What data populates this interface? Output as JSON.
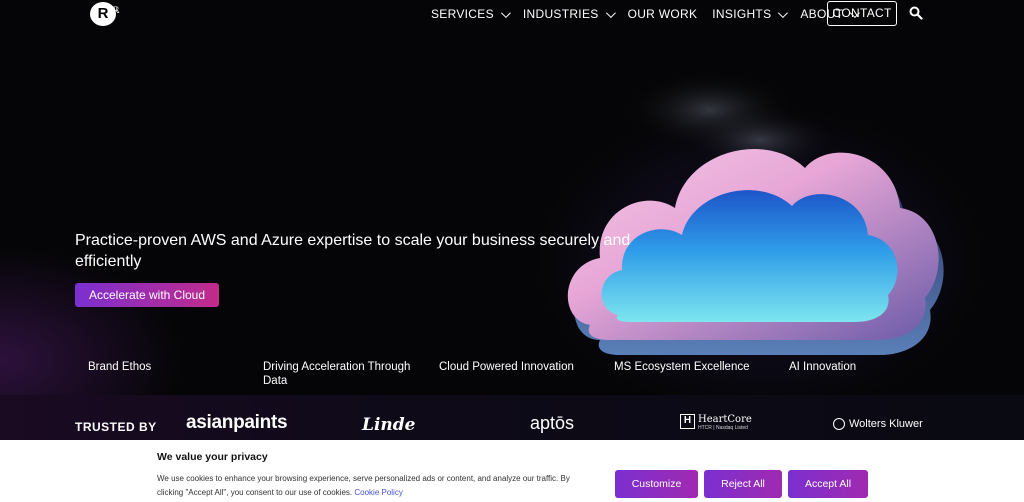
{
  "nav": {
    "logo_text": "R",
    "logo_mark": "ℝ",
    "items": [
      {
        "label": "SERVICES",
        "has_dropdown": true
      },
      {
        "label": "INDUSTRIES",
        "has_dropdown": true
      },
      {
        "label": "OUR WORK",
        "has_dropdown": false
      },
      {
        "label": "INSIGHTS",
        "has_dropdown": true
      },
      {
        "label": "ABOUT",
        "has_dropdown": true
      }
    ],
    "contact_label": "CONTACT",
    "search_icon": "search-icon"
  },
  "hero": {
    "headline": "Practice-proven AWS and Azure expertise to scale your business securely and efficiently",
    "cta_label": "Accelerate with Cloud"
  },
  "features": [
    "Brand Ethos",
    "Driving Acceleration Through Data",
    "Cloud Powered Innovation",
    "MS Ecosystem Excellence",
    "AI Innovation"
  ],
  "trusted": {
    "label": "TRUSTED BY",
    "brands": {
      "asianpaints": "asianpaints",
      "linde": "Linde",
      "aptos": "aptōs",
      "heartcore": "HeartCore",
      "heartcore_box": "H",
      "heartcore_sub": "HTCR | Nasdaq Listed",
      "wolters": "Wolters Kluwer"
    }
  },
  "cookie": {
    "title": "We value your privacy",
    "text": "We use cookies to enhance your browsing experience, serve personalized ads or content, and analyze our traffic. By clicking \"Accept All\", you consent to our use of cookies.",
    "link": "Cookie Policy",
    "customize": "Customize",
    "reject": "Reject All",
    "accept": "Accept All"
  },
  "colors": {
    "accent_purple": "#7b2fd0",
    "accent_pink": "#c22b8a",
    "link_blue": "#4a52d6"
  }
}
